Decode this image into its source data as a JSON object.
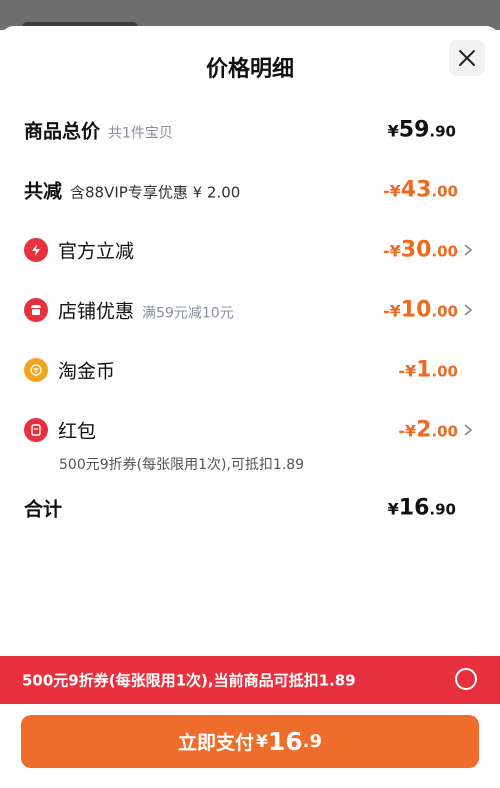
{
  "sheet": {
    "title": "价格明细"
  },
  "total_price": {
    "label": "商品总价",
    "sub": "共1件宝贝",
    "currency": "¥",
    "int": "59",
    "dec": ".90"
  },
  "total_discount": {
    "label": "共减",
    "sub": "含88VIP专享优惠 ¥ 2.00",
    "prefix": "-¥",
    "int": "43",
    "dec": ".00"
  },
  "discounts": [
    {
      "label": "官方立减",
      "sub": "",
      "prefix": "-¥",
      "int": "30",
      "dec": ".00",
      "icon": "lightning-icon",
      "color": "#e8313f"
    },
    {
      "label": "店铺优惠",
      "sub": "满59元减10元",
      "prefix": "-¥",
      "int": "10",
      "dec": ".00",
      "icon": "store-icon",
      "color": "#e8313f"
    },
    {
      "label": "淘金币",
      "sub": "",
      "prefix": "-¥",
      "int": "1",
      "dec": ".00",
      "icon": "coin-icon",
      "color": "#f2a51c"
    },
    {
      "label": "红包",
      "sub": "",
      "prefix": "-¥",
      "int": "2",
      "dec": ".00",
      "icon": "red-envelope-icon",
      "color": "#e8313f"
    }
  ],
  "red_envelope_note": "500元9折券(每张限用1次),可抵扣1.89",
  "sum": {
    "label": "合计",
    "currency": "¥",
    "int": "16",
    "dec": ".90"
  },
  "coupon_banner": {
    "text": "500元9折券(每张限用1次),当前商品可抵扣1.89"
  },
  "pay_button": {
    "label": "立即支付",
    "currency": "¥",
    "int": "16",
    "dec": ".9"
  },
  "colors": {
    "accent_orange": "#ef6a21",
    "banner_red": "#e8313f",
    "pay_button": "#ef6d2a"
  }
}
